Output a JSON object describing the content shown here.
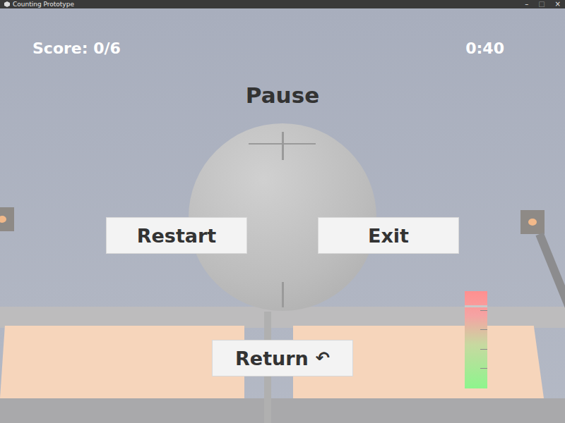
{
  "window": {
    "title": "Counting Prototype",
    "controls": [
      {
        "label": "–",
        "disabled": false
      },
      {
        "label": "□",
        "disabled": true
      },
      {
        "label": "×",
        "disabled": false
      }
    ]
  },
  "hud": {
    "score": "Score: 0/6",
    "timer": "0:40"
  },
  "pause_menu": {
    "title": "Pause",
    "buttons": [
      {
        "label": "Restart",
        "icon": ""
      },
      {
        "label": "Exit",
        "icon": ""
      },
      {
        "label": "Return",
        "icon": "↶"
      }
    ]
  },
  "power_meter": {
    "level": 0.83
  }
}
